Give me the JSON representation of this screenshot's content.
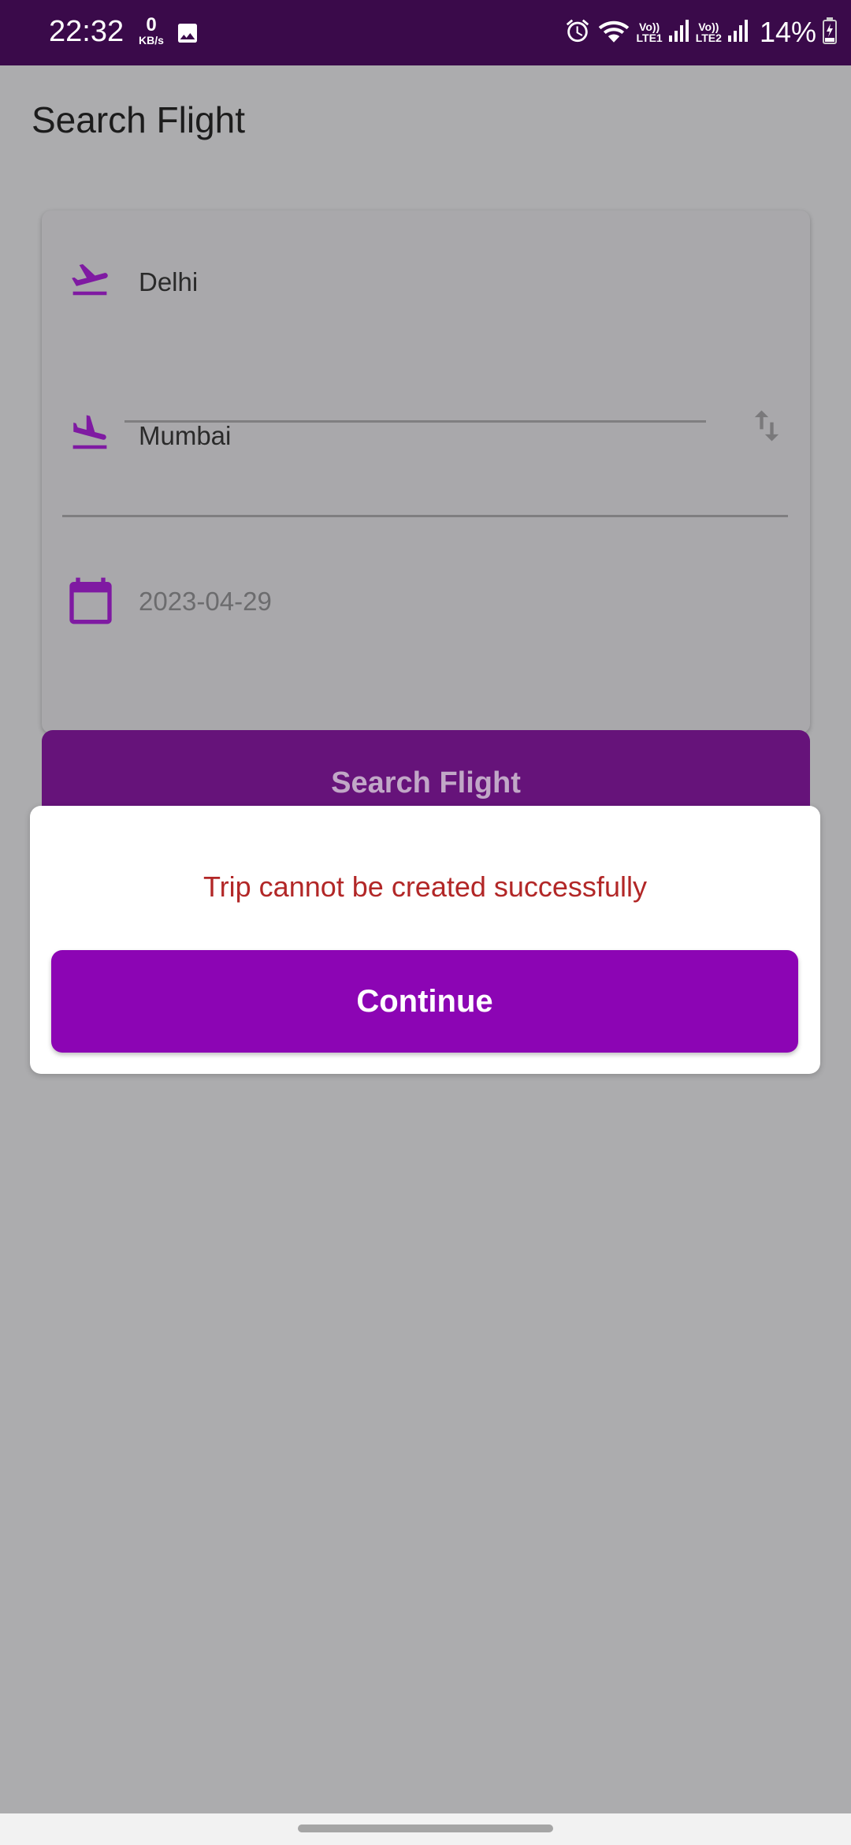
{
  "status_bar": {
    "time": "22:32",
    "net_speed_value": "0",
    "net_speed_unit": "KB/s",
    "sim1_label_top": "Vo))",
    "sim1_label_bottom": "LTE1",
    "sim2_label_top": "Vo))",
    "sim2_label_bottom": "LTE2",
    "battery": "14%",
    "icons": [
      "gallery-icon",
      "alarm-icon",
      "wifi-icon",
      "signal-icon",
      "battery-charging-icon"
    ]
  },
  "page": {
    "title": "Search Flight"
  },
  "form": {
    "from_value": "Delhi",
    "to_value": "Mumbai",
    "date_value": "2023-04-29",
    "icons": [
      "flight-takeoff-icon",
      "flight-land-icon",
      "swap-vertical-icon",
      "calendar-icon"
    ]
  },
  "search_button": {
    "label": "Search Flight"
  },
  "dialog": {
    "message": "Trip cannot be created successfully",
    "continue_label": "Continue"
  },
  "colors": {
    "accent": "#8c05b4",
    "status_bar": "#3a0a4a",
    "error_text": "#b22727",
    "icon_purple": "#8a1bb0"
  }
}
